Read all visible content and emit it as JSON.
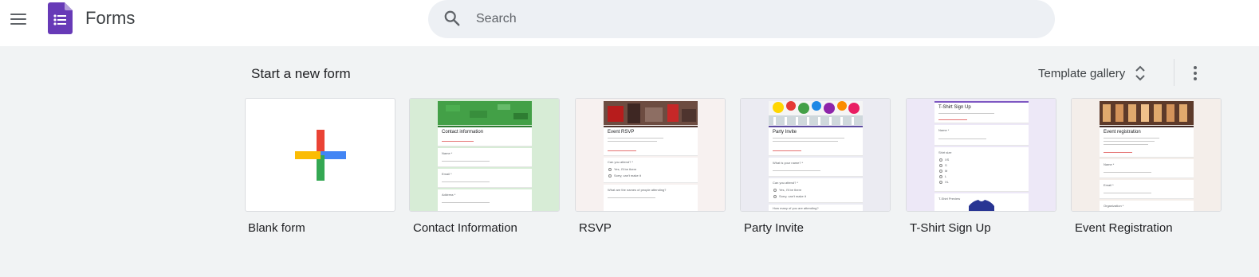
{
  "header": {
    "app_title": "Forms",
    "search_placeholder": "Search",
    "menu_icon": "hamburger-menu-icon",
    "logo_icon": "google-forms-logo",
    "search_icon": "search-icon"
  },
  "section": {
    "title": "Start a new form",
    "gallery_label": "Template gallery",
    "gallery_icon": "unfold-more-icon",
    "more_icon": "more-vert-icon"
  },
  "templates": [
    {
      "label": "Blank form"
    },
    {
      "label": "Contact Information",
      "preview": {
        "title": "Contact information",
        "fields": [
          "Name *",
          "Email *",
          "Address *"
        ]
      }
    },
    {
      "label": "RSVP",
      "preview": {
        "title": "Event RSVP",
        "questions": [
          "Can you attend? *",
          "What are the names of people attending?"
        ],
        "options": [
          "Yes, I'll be there",
          "Sorry, can't make it"
        ]
      }
    },
    {
      "label": "Party Invite",
      "preview": {
        "title": "Party Invite",
        "questions": [
          "What is your name? *",
          "Can you attend? *",
          "How many of you are attending?"
        ],
        "options": [
          "Yes, I'll be there",
          "Sorry, can't make it"
        ]
      }
    },
    {
      "label": "T-Shirt Sign Up",
      "preview": {
        "title": "T-Shirt Sign Up",
        "questions": [
          "Name *",
          "Shirt size",
          "T-Shirt Preview"
        ],
        "options": [
          "XS",
          "S",
          "M",
          "L",
          "XL"
        ]
      }
    },
    {
      "label": "Event Registration",
      "preview": {
        "title": "Event registration",
        "fields": [
          "Name *",
          "Email *",
          "Organization *"
        ]
      }
    }
  ],
  "colors": {
    "forms_purple": "#673ab7",
    "contact_green": "#43a047",
    "contact_bg": "#d7ecd6",
    "rsvp_bg": "#f7f1f0",
    "party_bg": "#ebebf2",
    "party_accent": "#5c4ba0",
    "tshirt_bg": "#ede8f7",
    "tshirt_accent": "#7e57c2",
    "event_bg": "#f4eeea",
    "event_accent": "#4a2c22"
  }
}
